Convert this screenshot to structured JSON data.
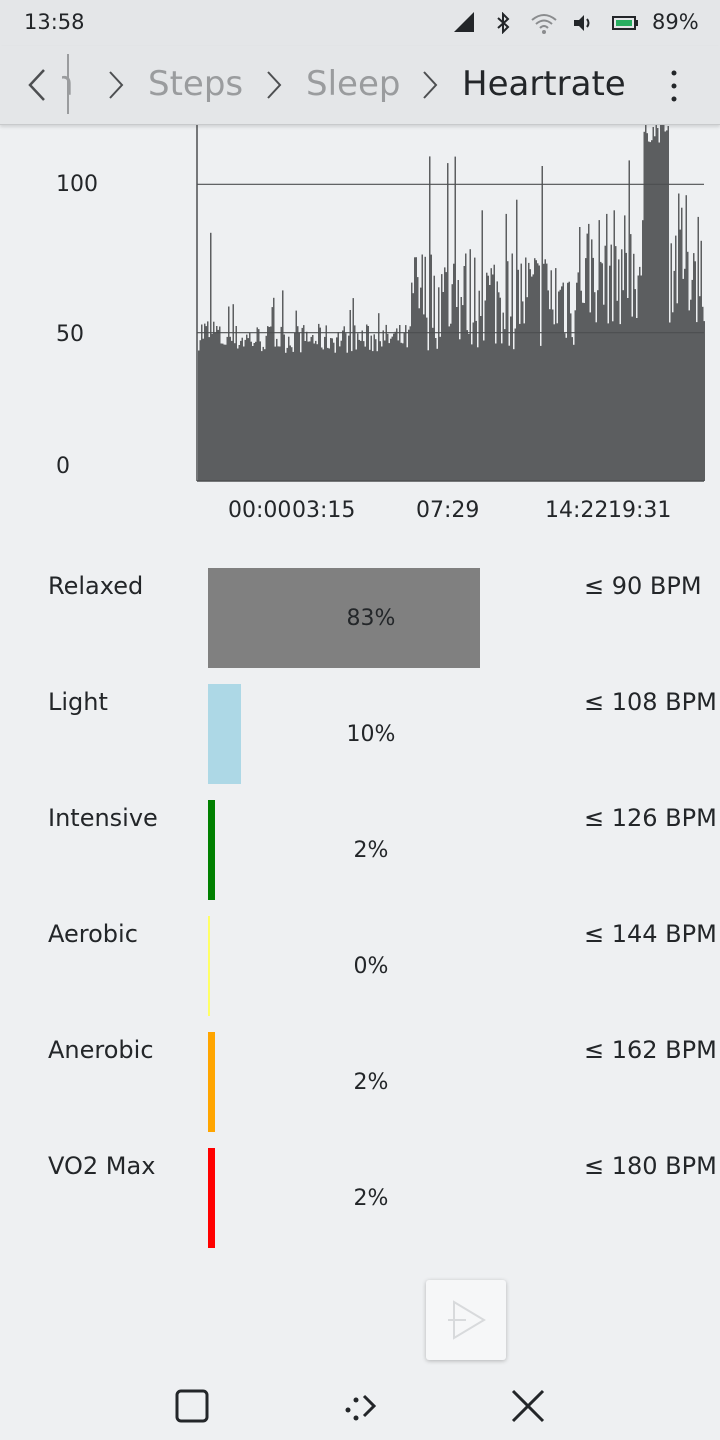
{
  "status_bar": {
    "time": "13:58",
    "battery": "89%",
    "icons": [
      "signal-icon",
      "bluetooth-icon",
      "wifi-icon",
      "volume-icon",
      "battery-icon"
    ]
  },
  "toolbar": {
    "truncated_crumb": "h",
    "breadcrumbs": [
      "Steps",
      "Sleep",
      "Heartrate"
    ],
    "active": "Heartrate"
  },
  "chart_data": {
    "type": "bar",
    "y_ticks": [
      "100",
      "50",
      "0"
    ],
    "x_ticks": [
      "00:00",
      "03:15",
      "07:29",
      "14:22",
      "19:31"
    ],
    "ylim": [
      0,
      120
    ],
    "gridlines": [
      50,
      100
    ],
    "bar_color": "#5c5e60",
    "segments": [
      {
        "from": 0.0,
        "to": 0.04,
        "base": 50,
        "noise": 6,
        "spike": 90
      },
      {
        "from": 0.04,
        "to": 0.42,
        "base": 48,
        "noise": 5,
        "spike": 65
      },
      {
        "from": 0.42,
        "to": 0.75,
        "base": 62,
        "noise": 18,
        "spike": 118
      },
      {
        "from": 0.75,
        "to": 0.88,
        "base": 72,
        "noise": 20,
        "spike": 118
      },
      {
        "from": 0.88,
        "to": 0.93,
        "base": 118,
        "noise": 4,
        "spike": 120
      },
      {
        "from": 0.93,
        "to": 1.0,
        "base": 75,
        "noise": 22,
        "spike": 118
      }
    ]
  },
  "zones": [
    {
      "label": "Relaxed",
      "percent": "83%",
      "fraction": 0.83,
      "bpm": "≤ 90 BPM",
      "color": "#808080"
    },
    {
      "label": "Light",
      "percent": "10%",
      "fraction": 0.1,
      "bpm": "≤ 108 BPM",
      "color": "#add8e6"
    },
    {
      "label": "Intensive",
      "percent": "2%",
      "fraction": 0.02,
      "bpm": "≤ 126 BPM",
      "color": "#008000"
    },
    {
      "label": "Aerobic",
      "percent": "0%",
      "fraction": 0.004,
      "bpm": "≤ 144 BPM",
      "color": "#ffff66"
    },
    {
      "label": "Anerobic",
      "percent": "2%",
      "fraction": 0.02,
      "bpm": "≤ 162 BPM",
      "color": "#ffa500"
    },
    {
      "label": "VO2 Max",
      "percent": "2%",
      "fraction": 0.02,
      "bpm": "≤ 180 BPM",
      "color": "#ff0000"
    }
  ]
}
